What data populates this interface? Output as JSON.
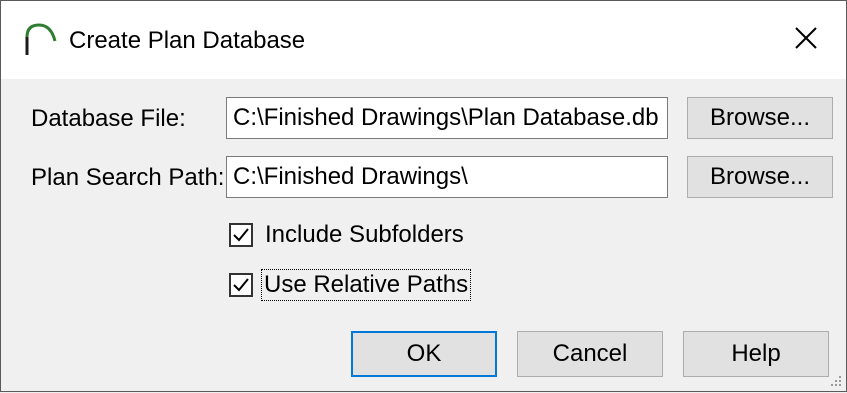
{
  "window": {
    "title": "Create Plan Database",
    "icon": "arch-icon",
    "close_icon": "close-icon"
  },
  "database_file": {
    "label": "Database File:",
    "value": "C:\\Finished Drawings\\Plan Database.db",
    "browse_label": "Browse..."
  },
  "plan_search_path": {
    "label": "Plan Search Path:",
    "value": "C:\\Finished Drawings\\",
    "browse_label": "Browse..."
  },
  "options": [
    {
      "label": "Include Subfolders",
      "checked": true
    },
    {
      "label": "Use Relative Paths",
      "checked": true,
      "focused": true
    }
  ],
  "buttons": {
    "ok": "OK",
    "cancel": "Cancel",
    "help": "Help"
  },
  "colors": {
    "accent": "#0078d7",
    "dialog_bg": "#f0f0f0",
    "titlebar_bg": "#ffffff"
  }
}
